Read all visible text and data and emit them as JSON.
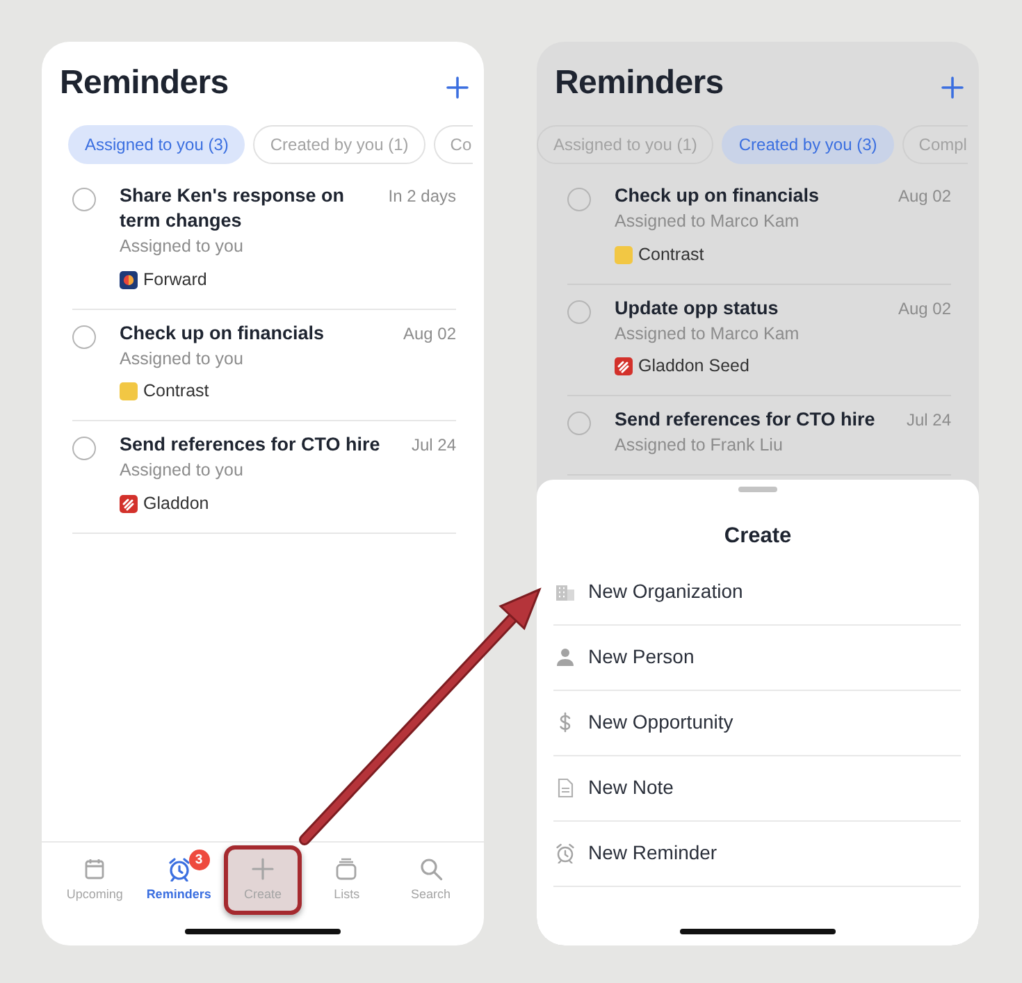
{
  "screens": [
    {
      "title": "Reminders",
      "dimmed": false,
      "filters": [
        {
          "label": "Assigned to you (3)",
          "selected": true
        },
        {
          "label": "Created by you (1)",
          "selected": false
        },
        {
          "label": "Co",
          "selected": false
        }
      ],
      "reminders": [
        {
          "title": "Share Ken's response on term changes",
          "due": "In 2 days",
          "assignee": "Assigned to you",
          "org": "Forward",
          "kind": "forward"
        },
        {
          "title": "Check up on financials",
          "due": "Aug 02",
          "assignee": "Assigned to you",
          "org": "Contrast",
          "kind": "contrast"
        },
        {
          "title": "Send references for CTO hire",
          "due": "Jul 24",
          "assignee": "Assigned to you",
          "org": "Gladdon",
          "kind": "gladdon"
        }
      ],
      "tab_bar": [
        {
          "label": "Upcoming",
          "kind": "calendar",
          "selected": false,
          "highlighted": false
        },
        {
          "label": "Reminders",
          "kind": "alarm",
          "selected": true,
          "highlighted": false,
          "badge": "3"
        },
        {
          "label": "Create",
          "kind": "plus",
          "selected": false,
          "highlighted": true
        },
        {
          "label": "Lists",
          "kind": "stack",
          "selected": false,
          "highlighted": false
        },
        {
          "label": "Search",
          "kind": "search",
          "selected": false,
          "highlighted": false
        }
      ]
    },
    {
      "title": "Reminders",
      "dimmed": true,
      "filters": [
        {
          "label": "Assigned to you (1)",
          "selected": false
        },
        {
          "label": "Created by you (3)",
          "selected": true
        },
        {
          "label": "Compl",
          "selected": false
        }
      ],
      "reminders": [
        {
          "title": "Check up on financials",
          "due": "Aug 02",
          "assignee": "Assigned to Marco Kam",
          "org": "Contrast",
          "kind": "contrast"
        },
        {
          "title": "Update opp status",
          "due": "Aug 02",
          "assignee": "Assigned to Marco Kam",
          "org": "Gladdon Seed",
          "kind": "gladdon"
        },
        {
          "title": "Send references for CTO hire",
          "due": "Jul 24",
          "assignee": "Assigned to Frank Liu"
        }
      ],
      "sheet": {
        "title": "Create",
        "items": [
          {
            "label": "New Organization",
            "kind": "building"
          },
          {
            "label": "New Person",
            "kind": "person"
          },
          {
            "label": "New Opportunity",
            "kind": "dollar"
          },
          {
            "label": "New Note",
            "kind": "note"
          },
          {
            "label": "New Reminder",
            "kind": "alarm"
          }
        ]
      }
    }
  ]
}
